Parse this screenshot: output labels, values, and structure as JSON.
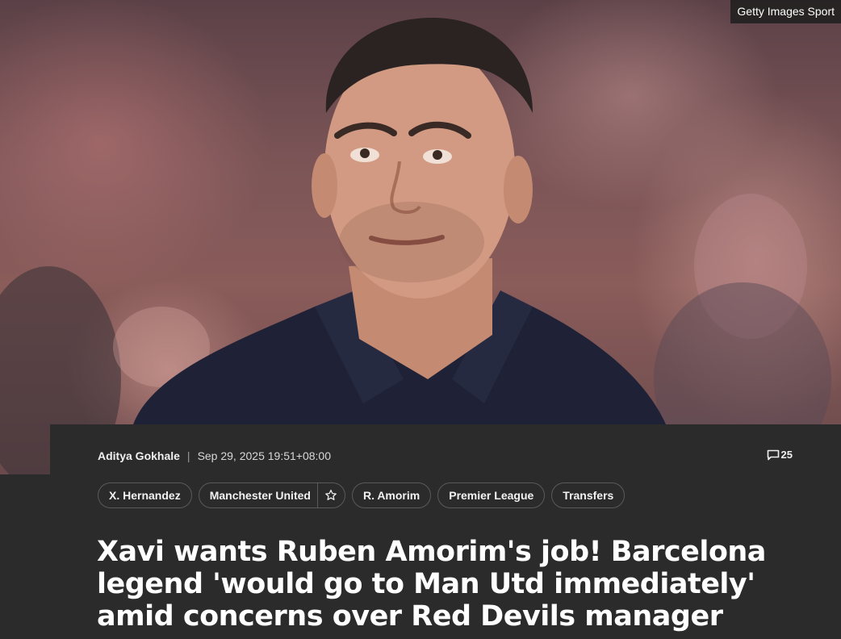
{
  "image": {
    "credit": "Getty Images Sport",
    "subject": "portrait photo of a man"
  },
  "article": {
    "author": "Aditya Gokhale",
    "separator": "|",
    "timestamp": "Sep 29, 2025 19:51+08:00",
    "comment_count": "25",
    "tags": [
      {
        "label": "X. Hernandez"
      },
      {
        "label": "Manchester United"
      },
      {
        "label": "R. Amorim"
      },
      {
        "label": "Premier League"
      },
      {
        "label": "Transfers"
      }
    ],
    "headline": "Xavi wants Ruben Amorim's job! Barcelona legend 'would go to Man Utd immediately' amid concerns over Red Devils manager"
  },
  "colors": {
    "background": "#2b2b2b",
    "text": "#ffffff",
    "tag_border": "#5a5a5a"
  }
}
